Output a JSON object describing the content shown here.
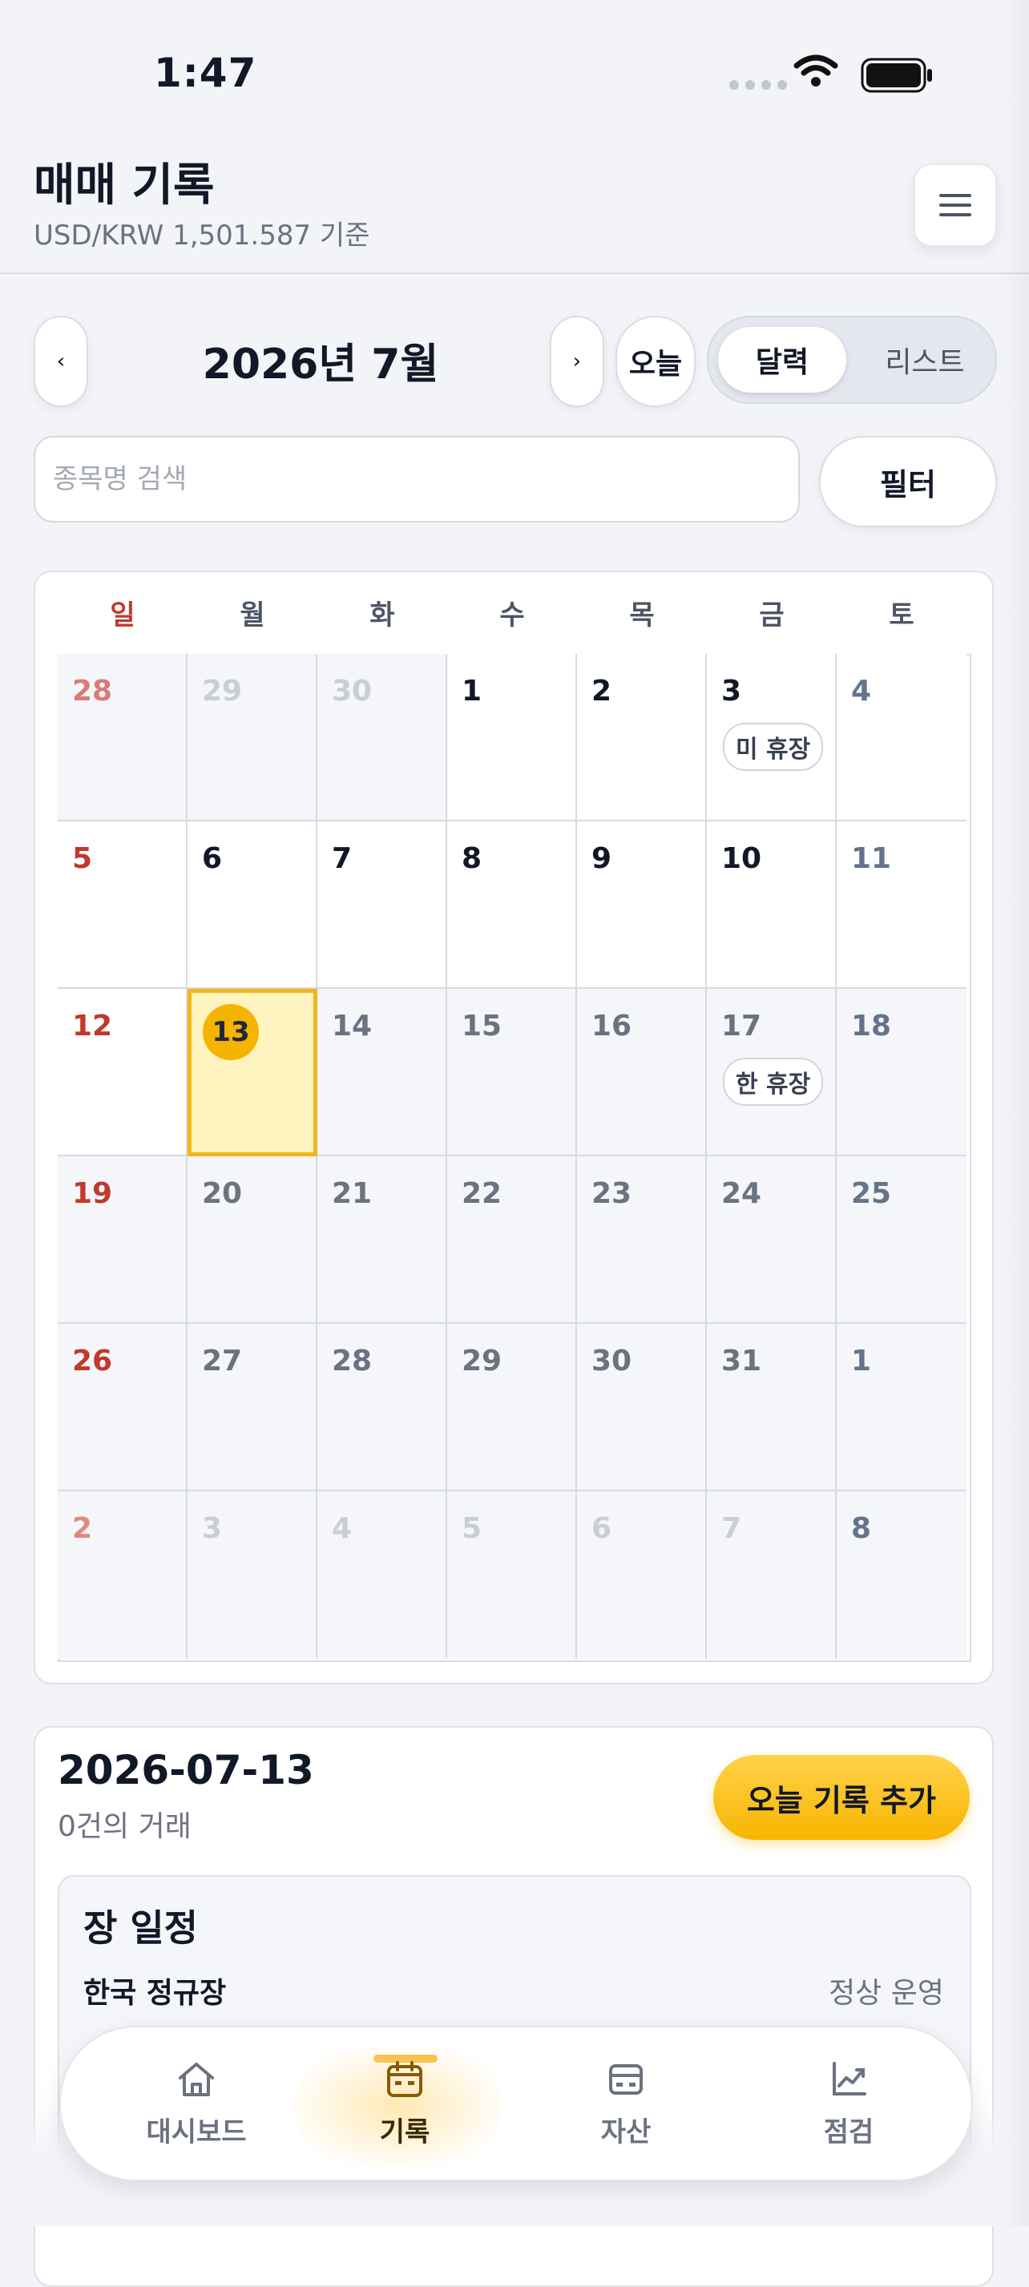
{
  "status_bar": {
    "time": "1:47"
  },
  "header": {
    "title": "매매 기록",
    "subtitle": "USD/KRW 1,501.587 기준"
  },
  "month_nav": {
    "prev": "‹",
    "label": "2026년 7월",
    "next": "›",
    "today": "오늘"
  },
  "view_toggle": {
    "calendar": "달력",
    "list": "리스트",
    "selected": "달력"
  },
  "search": {
    "placeholder": "종목명 검색",
    "value": ""
  },
  "filter_label": "필터",
  "calendar": {
    "weekdays": [
      "일",
      "월",
      "화",
      "수",
      "목",
      "금",
      "토"
    ],
    "weeks": [
      [
        "28",
        "29",
        "30",
        "1",
        "2",
        "3",
        "4"
      ],
      [
        "5",
        "6",
        "7",
        "8",
        "9",
        "10",
        "11"
      ],
      [
        "12",
        "13",
        "14",
        "15",
        "16",
        "17",
        "18"
      ],
      [
        "19",
        "20",
        "21",
        "22",
        "23",
        "24",
        "25"
      ],
      [
        "26",
        "27",
        "28",
        "29",
        "30",
        "31",
        "1"
      ],
      [
        "2",
        "3",
        "4",
        "5",
        "6",
        "7",
        "8"
      ]
    ],
    "badges": {
      "w0d5": "미 휴장",
      "w2d5": "한 휴장"
    },
    "today": "13"
  },
  "day_detail": {
    "date": "2026-07-13",
    "trade_count": "0건의 거래",
    "add_button": "오늘 기록 추가",
    "schedule_title": "장 일정",
    "schedule_rows": [
      {
        "label": "한국 정규장",
        "value": "정상 운영"
      }
    ]
  },
  "bottom_nav": [
    {
      "label": "대시보드",
      "icon": "home-icon"
    },
    {
      "label": "기록",
      "icon": "calendar-icon",
      "active": true
    },
    {
      "label": "자산",
      "icon": "wallet-icon"
    },
    {
      "label": "점검",
      "icon": "chart-line-icon"
    }
  ],
  "colors": {
    "accent": "#f5b400",
    "sunday": "#c0392b",
    "muted": "#6b7280",
    "faded": "#c9ced6",
    "today_fill": "#fff3bf"
  }
}
